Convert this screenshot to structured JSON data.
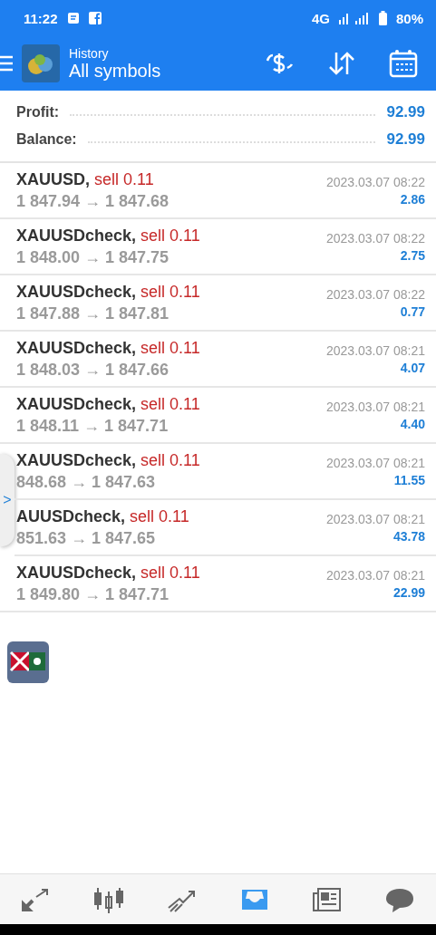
{
  "status_bar": {
    "time": "11:22",
    "network": "4G",
    "battery": "80%"
  },
  "header": {
    "subtitle": "History",
    "title": "All symbols"
  },
  "summary": [
    {
      "label": "Profit:",
      "value": "92.99"
    },
    {
      "label": "Balance:",
      "value": "92.99"
    }
  ],
  "trades": [
    {
      "symbol": "XAUUSD,",
      "side": "sell 0.11",
      "prices": "1 847.94 → 1 847.68",
      "time": "2023.03.07 08:22",
      "profit": "2.86"
    },
    {
      "symbol": "XAUUSDcheck,",
      "side": "sell 0.11",
      "prices": "1 848.00 → 1 847.75",
      "time": "2023.03.07 08:22",
      "profit": "2.75"
    },
    {
      "symbol": "XAUUSDcheck,",
      "side": "sell 0.11",
      "prices": "1 847.88 → 1 847.81",
      "time": "2023.03.07 08:22",
      "profit": "0.77"
    },
    {
      "symbol": "XAUUSDcheck,",
      "side": "sell 0.11",
      "prices": "1 848.03 → 1 847.66",
      "time": "2023.03.07 08:21",
      "profit": "4.07"
    },
    {
      "symbol": "XAUUSDcheck,",
      "side": "sell 0.11",
      "prices": "1 848.11 → 1 847.71",
      "time": "2023.03.07 08:21",
      "profit": "4.40"
    },
    {
      "symbol": "XAUUSDcheck,",
      "side": "sell 0.11",
      "prices": "848.68 → 1 847.63",
      "time": "2023.03.07 08:21",
      "profit": "11.55",
      "beside_handle": true
    },
    {
      "symbol": "AUUSDcheck,",
      "side": "sell 0.11",
      "prices": "851.63 → 1 847.65",
      "time": "2023.03.07 08:21",
      "profit": "43.78",
      "beside_handle": true
    },
    {
      "symbol": "XAUUSDcheck,",
      "side": "sell 0.11",
      "prices": "1 849.80 → 1 847.71",
      "time": "2023.03.07 08:21",
      "profit": "22.99"
    }
  ],
  "side_handle": {
    "label": ">"
  },
  "bottom_nav": [
    {
      "kind": "quotes",
      "selected": false
    },
    {
      "kind": "chart",
      "selected": false
    },
    {
      "kind": "trade",
      "selected": false
    },
    {
      "kind": "history",
      "selected": true
    },
    {
      "kind": "news",
      "selected": false
    },
    {
      "kind": "chat",
      "selected": false
    }
  ]
}
